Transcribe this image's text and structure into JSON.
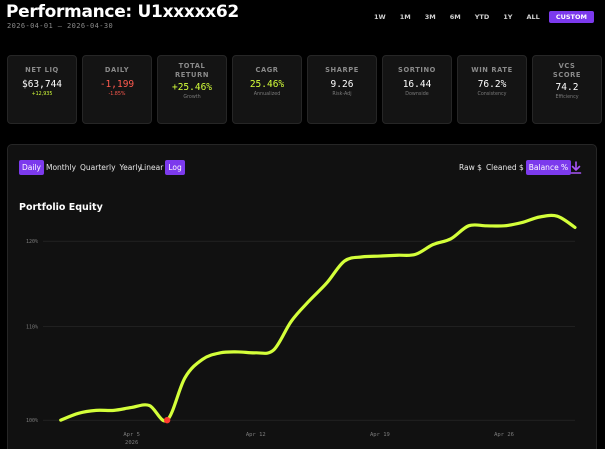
{
  "header": {
    "title": "Performance: U1xxxxx62",
    "date_range": "2026-04-01 — 2026-04-30"
  },
  "ranges": [
    {
      "label": "1W",
      "active": false
    },
    {
      "label": "1M",
      "active": false
    },
    {
      "label": "3M",
      "active": false
    },
    {
      "label": "6M",
      "active": false
    },
    {
      "label": "YTD",
      "active": false
    },
    {
      "label": "1Y",
      "active": false
    },
    {
      "label": "ALL",
      "active": false
    },
    {
      "label": "CUSTOM",
      "active": true
    }
  ],
  "cards": [
    {
      "label": "NET LIQ",
      "value": "$63,744",
      "sub": "+12,935",
      "value_tone": "plain",
      "sub_tone": "pos"
    },
    {
      "label": "DAILY",
      "value": "-1,199",
      "sub": "-1.85%",
      "value_tone": "neg",
      "sub_tone": "neg"
    },
    {
      "label": "TOTAL RETURN",
      "value": "+25.46%",
      "sub": "Growth",
      "value_tone": "pos",
      "sub_tone": "plain"
    },
    {
      "label": "CAGR",
      "value": "25.46%",
      "sub": "Annualized",
      "value_tone": "pos",
      "sub_tone": "plain"
    },
    {
      "label": "SHARPE",
      "value": "9.26",
      "sub": "Risk-Adj",
      "value_tone": "plain",
      "sub_tone": "plain"
    },
    {
      "label": "SORTINO",
      "value": "16.44",
      "sub": "Downside",
      "value_tone": "plain",
      "sub_tone": "plain"
    },
    {
      "label": "WIN RATE",
      "value": "76.2%",
      "sub": "Consistency",
      "value_tone": "plain",
      "sub_tone": "plain"
    },
    {
      "label": "VCS SCORE",
      "value": "74.2",
      "sub": "Efficiency",
      "value_tone": "plain",
      "sub_tone": "plain"
    }
  ],
  "panel": {
    "period_toggle": [
      {
        "label": "Daily",
        "active": true
      },
      {
        "label": "Monthly",
        "active": false
      },
      {
        "label": "Quarterly",
        "active": false
      },
      {
        "label": "Yearly",
        "active": false
      }
    ],
    "scale_toggle": [
      {
        "label": "Linear",
        "active": false
      },
      {
        "label": "Log",
        "active": true
      }
    ],
    "mode_toggle": [
      {
        "label": "Raw $",
        "active": false
      },
      {
        "label": "Cleaned $",
        "active": false
      },
      {
        "label": "Balance %",
        "active": true
      }
    ],
    "download_icon": "download-icon"
  },
  "chart_data": {
    "type": "line",
    "title": "Portfolio Equity",
    "scale": "log",
    "ylim": [
      99,
      123
    ],
    "yticks": [
      {
        "value": 100,
        "label": "100%"
      },
      {
        "value": 110,
        "label": "110%"
      },
      {
        "value": 120,
        "label": "120%"
      }
    ],
    "xlim": [
      "2026-03-31",
      "2026-04-30"
    ],
    "xticks": [
      {
        "date": "2026-04-05",
        "label": "Apr 5",
        "sublabel": "2026"
      },
      {
        "date": "2026-04-12",
        "label": "Apr 12",
        "sublabel": ""
      },
      {
        "date": "2026-04-19",
        "label": "Apr 19",
        "sublabel": ""
      },
      {
        "date": "2026-04-26",
        "label": "Apr 26",
        "sublabel": ""
      }
    ],
    "grid": true,
    "line_color": "#d4ff3a",
    "drawdown_color": "#ff3b30",
    "x": [
      "2026-04-01",
      "2026-04-02",
      "2026-04-03",
      "2026-04-04",
      "2026-04-05",
      "2026-04-06",
      "2026-04-07",
      "2026-04-08",
      "2026-04-09",
      "2026-04-10",
      "2026-04-11",
      "2026-04-12",
      "2026-04-13",
      "2026-04-14",
      "2026-04-15",
      "2026-04-16",
      "2026-04-17",
      "2026-04-18",
      "2026-04-19",
      "2026-04-20",
      "2026-04-21",
      "2026-04-22",
      "2026-04-23",
      "2026-04-24",
      "2026-04-25",
      "2026-04-26",
      "2026-04-27",
      "2026-04-28",
      "2026-04-29",
      "2026-04-30"
    ],
    "values": [
      100.0,
      100.7,
      101.0,
      101.0,
      101.3,
      101.5,
      100.0,
      104.4,
      106.4,
      107.1,
      107.2,
      107.1,
      107.4,
      110.6,
      112.9,
      115.0,
      117.6,
      118.1,
      118.2,
      118.3,
      118.4,
      119.6,
      120.3,
      121.9,
      121.9,
      121.9,
      122.3,
      123.0,
      123.1,
      121.7
    ],
    "drawdown_point": {
      "x": "2026-04-07",
      "value": 100.0
    }
  },
  "colors": {
    "accent": "#7c3aed",
    "positive": "#d4ff3a",
    "negative": "#ff5a4f",
    "background": "#000000",
    "panel": "#111111"
  }
}
